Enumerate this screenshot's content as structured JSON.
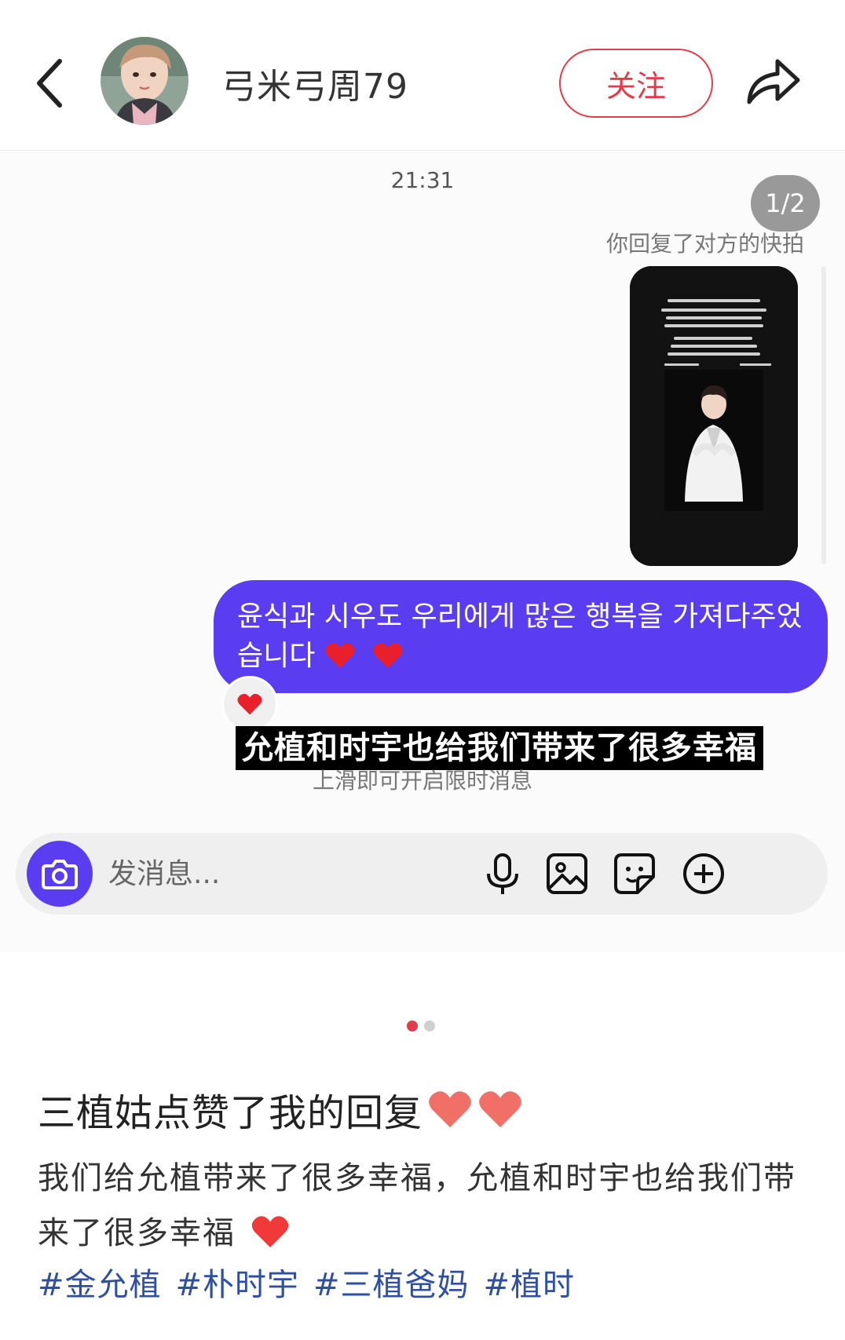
{
  "header": {
    "username": "弓米弓周79",
    "follow_label": "关注"
  },
  "chat": {
    "time": "21:31",
    "image_counter": "1/2",
    "reply_note": "你回复了对方的快拍",
    "message_text": "윤식과 시우도 우리에게 많은 행복을 가져다주었습니다",
    "caption": "允植和时宇也给我们带来了很多幸福",
    "swipe_hint": "上滑即可开启限时消息",
    "input_placeholder": "发消息..."
  },
  "pager": {
    "total": 2,
    "active": 1
  },
  "post": {
    "title": "三植姑点赞了我的回复",
    "body": "我们给允植带来了很多幸福，允植和时宇也给我们带来了很多幸福",
    "tags": [
      "#金允植",
      "#朴时宇",
      "#三植爸妈",
      "#植时"
    ]
  },
  "colors": {
    "accent": "#e23c4a",
    "bubble": "#5a3df0",
    "tag": "#2f4fa0"
  }
}
